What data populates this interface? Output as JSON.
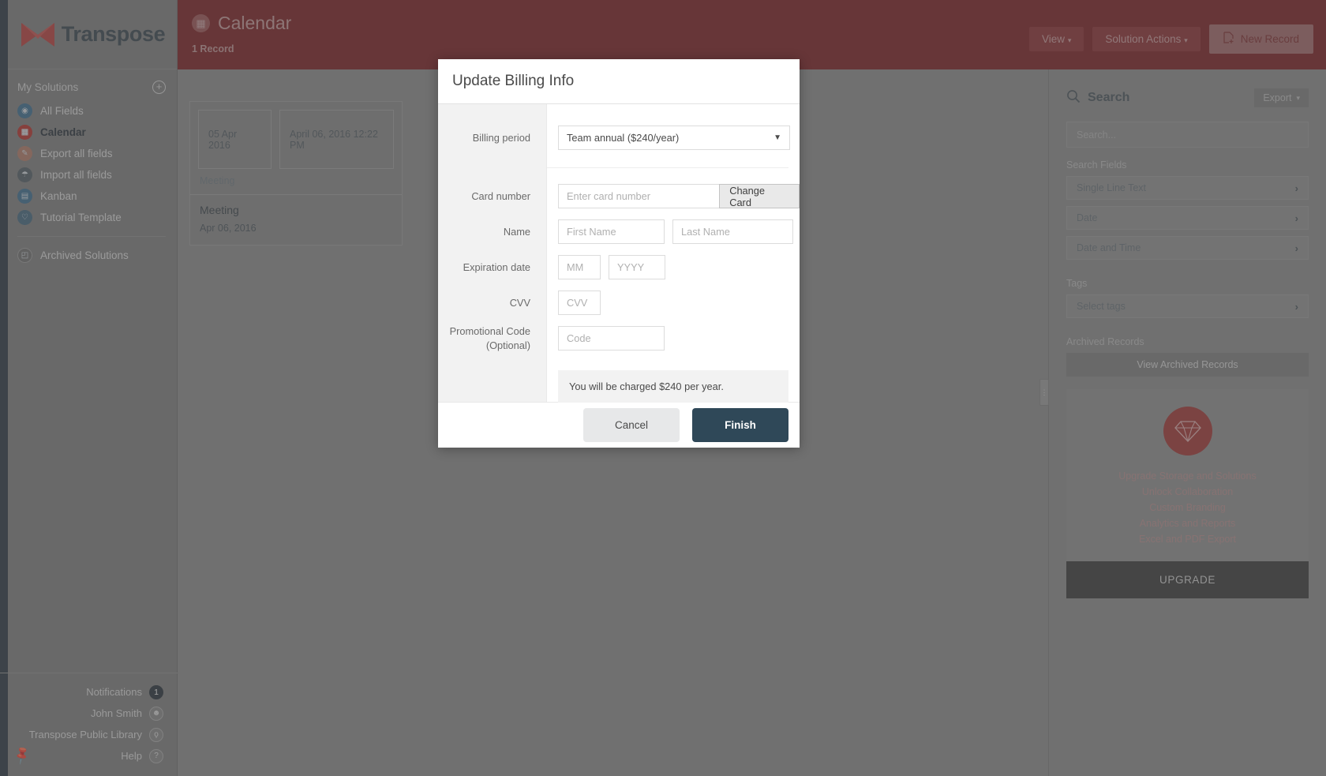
{
  "brand": {
    "name": "Transpose",
    "accent": "#7b2226"
  },
  "left_sidebar": {
    "section_label": "My Solutions",
    "add_label": "+",
    "items": [
      {
        "label": "All Fields",
        "icon": "target-icon"
      },
      {
        "label": "Calendar",
        "icon": "calendar-icon"
      },
      {
        "label": "Export all fields",
        "icon": "pencil-icon"
      },
      {
        "label": "Import all fields",
        "icon": "import-icon"
      },
      {
        "label": "Kanban",
        "icon": "board-icon"
      },
      {
        "label": "Tutorial Template",
        "icon": "heart-icon"
      }
    ],
    "archived": {
      "label": "Archived Solutions",
      "icon": "box-icon"
    },
    "bottom": [
      {
        "label": "Notifications",
        "badge": "1",
        "icon": "bell-badge-icon"
      },
      {
        "label": "John Smith",
        "icon": "avatar-icon"
      },
      {
        "label": "Transpose Public Library",
        "icon": "lightbulb-icon"
      },
      {
        "label": "Help",
        "icon": "question-icon"
      }
    ],
    "pin": "pin-icon"
  },
  "topbar": {
    "title": "Calendar",
    "record_count": "1 Record",
    "view_label": "View",
    "solution_actions_label": "Solution Actions",
    "new_record_label": "New Record"
  },
  "record_card": {
    "date_field": "05 Apr 2016",
    "datetime_field": "April 06, 2016 12:22 PM",
    "subtitle": "Meeting",
    "foot_title": "Meeting",
    "foot_date": "Apr 06, 2016"
  },
  "right_sidebar": {
    "search_heading": "Search",
    "export_label": "Export",
    "search_placeholder": "Search...",
    "search_fields_label": "Search Fields",
    "search_fields": [
      "Single Line Text",
      "Date",
      "Date and Time"
    ],
    "tags_label": "Tags",
    "tags_placeholder": "Select tags",
    "archived_records_label": "Archived Records",
    "view_archived_label": "View Archived Records",
    "upgrade": {
      "icon": "diamond-icon",
      "features": [
        "Upgrade Storage and Solutions",
        "Unlock Collaboration",
        "Custom Branding",
        "Analytics and Reports",
        "Excel and PDF Export"
      ],
      "button_label": "UPGRADE"
    }
  },
  "modal": {
    "title": "Update Billing Info",
    "labels": {
      "billing_period": "Billing period",
      "card_number": "Card number",
      "name": "Name",
      "expiration_date": "Expiration date",
      "cvv": "CVV",
      "promo_line1": "Promotional Code",
      "promo_line2": "(Optional)"
    },
    "billing_period_value": "Team annual ($240/year)",
    "card_number_placeholder": "Enter card number",
    "change_card_label": "Change Card",
    "first_name_placeholder": "First Name",
    "last_name_placeholder": "Last Name",
    "mm_placeholder": "MM",
    "yyyy_placeholder": "YYYY",
    "cvv_placeholder": "CVV",
    "code_placeholder": "Code",
    "charge_note": "You will be charged $240 per year.",
    "cancel_label": "Cancel",
    "finish_label": "Finish"
  }
}
